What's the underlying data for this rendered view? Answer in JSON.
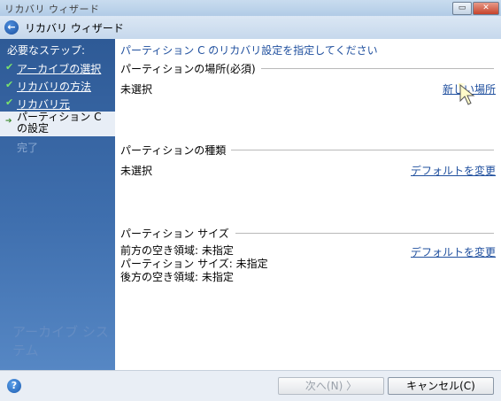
{
  "window": {
    "title": "リカバリ ウィザード",
    "header_title": "リカバリ ウィザード"
  },
  "sidebar": {
    "heading": "必要なステップ:",
    "steps": [
      {
        "label": "アーカイブの選択",
        "state": "done"
      },
      {
        "label": "リカバリの方法",
        "state": "done"
      },
      {
        "label": "リカバリ元",
        "state": "done"
      },
      {
        "label": "パーティション C",
        "label2": "の設定",
        "state": "active"
      },
      {
        "label": "完了",
        "state": "pending"
      }
    ],
    "watermark": "アーカイブ システム"
  },
  "main": {
    "instruction": "パーティション C のリカバリ設定を指定してください",
    "location": {
      "title": "パーティションの場所(必須)",
      "value": "未選択",
      "link": "新しい場所"
    },
    "type": {
      "title": "パーティションの種類",
      "value": "未選択",
      "link": "デフォルトを変更"
    },
    "size": {
      "title": "パーティション サイズ",
      "lines": [
        "前方の空き領域: 未指定",
        "パーティション サイズ: 未指定",
        "後方の空き領域: 未指定"
      ],
      "link": "デフォルトを変更"
    }
  },
  "footer": {
    "next_label": "次へ(N) 〉",
    "cancel_label": "キャンセル(C)"
  }
}
